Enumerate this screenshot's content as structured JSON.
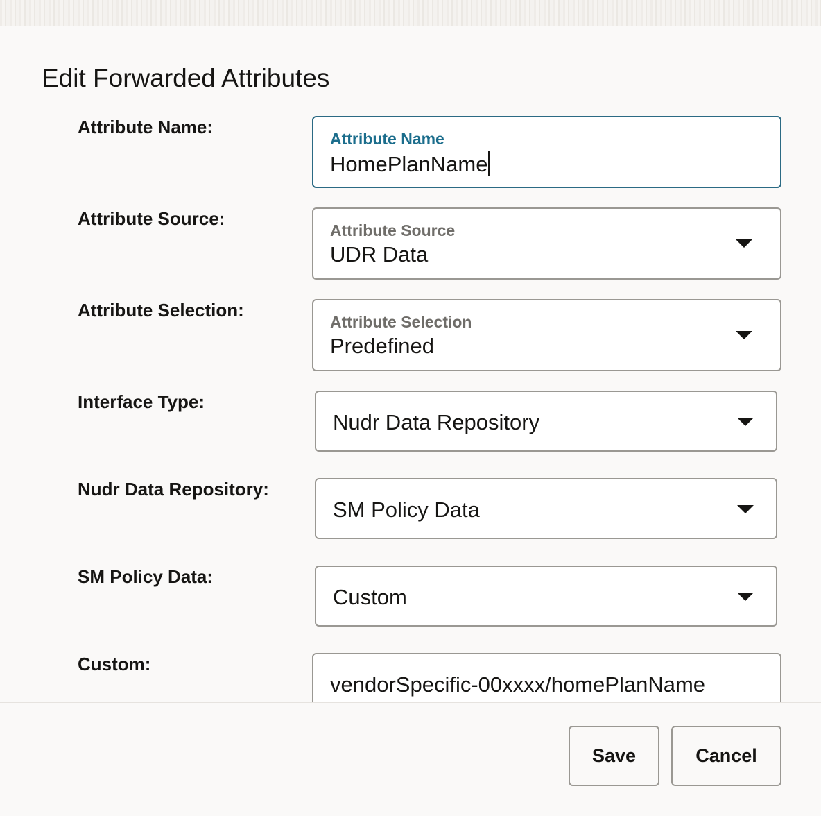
{
  "dialog": {
    "title": "Edit Forwarded Attributes"
  },
  "fields": {
    "attribute_name": {
      "label": "Attribute Name:",
      "float_label": "Attribute Name",
      "value": "HomePlanName"
    },
    "attribute_source": {
      "label": "Attribute Source:",
      "float_label": "Attribute Source",
      "value": "UDR Data"
    },
    "attribute_selection": {
      "label": "Attribute Selection:",
      "float_label": "Attribute Selection",
      "value": "Predefined"
    },
    "interface_type": {
      "label": "Interface Type:",
      "value": "Nudr Data Repository"
    },
    "nudr_data_repository": {
      "label": "Nudr Data Repository:",
      "value": "SM Policy Data"
    },
    "sm_policy_data": {
      "label": "SM Policy Data:",
      "value": "Custom"
    },
    "custom": {
      "label": "Custom:",
      "value": "vendorSpecific-00xxxx/homePlanName"
    }
  },
  "footer": {
    "save_label": "Save",
    "cancel_label": "Cancel"
  },
  "icons": {
    "dropdown": "chevron-down-icon"
  },
  "colors": {
    "focus_border": "#2b6a84",
    "focus_label": "#1b6d8c",
    "border": "#9a9893",
    "background": "#faf9f8"
  }
}
